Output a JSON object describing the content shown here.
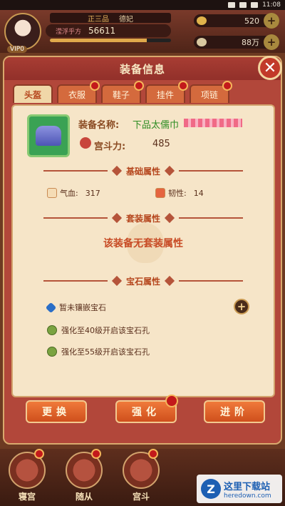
{
  "status_bar": {
    "time": "11:08"
  },
  "hud": {
    "vip_label": "VIP0",
    "rank": "正三品",
    "title": "德妃",
    "player_name": "滢浮乎方",
    "power": "56611",
    "hp_percent": 80,
    "gold": "520",
    "silver": "88万"
  },
  "dialog": {
    "title": "装备信息",
    "tabs": [
      {
        "label": "头盔",
        "active": true
      },
      {
        "label": "衣服",
        "active": false
      },
      {
        "label": "鞋子",
        "active": false
      },
      {
        "label": "挂件",
        "active": false
      },
      {
        "label": "项链",
        "active": false
      }
    ],
    "item": {
      "name_label": "装备名称:",
      "name_value": "下品太儒巾",
      "power_label": "宫斗力:",
      "power_value": "485"
    },
    "sections": {
      "basic": "基础属性",
      "set": "套装属性",
      "gem": "宝石属性"
    },
    "attributes": [
      {
        "label": "气血:",
        "value": "317"
      },
      {
        "label": "韧性:",
        "value": "14"
      }
    ],
    "set_note": "该装备无套装属性",
    "gems": [
      {
        "text": "暂未镶嵌宝石",
        "icon": "diamond-icon"
      },
      {
        "text": "强化至40级开启该宝石孔",
        "icon": "lock-icon"
      },
      {
        "text": "强化至55级开启该宝石孔",
        "icon": "lock-icon"
      }
    ],
    "buttons": {
      "replace": "更换",
      "enhance": "强化",
      "advance": "进阶"
    }
  },
  "bottom_nav": [
    {
      "label": "寝宫"
    },
    {
      "label": "随从"
    },
    {
      "label": "宫斗"
    }
  ],
  "watermark": {
    "title": "这里下载站",
    "url": "heredown.com"
  }
}
